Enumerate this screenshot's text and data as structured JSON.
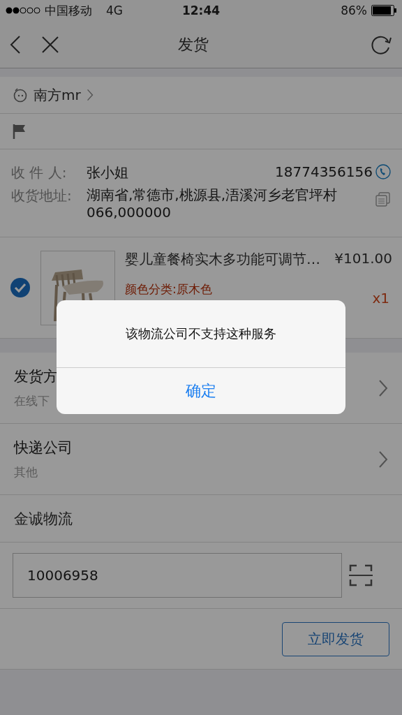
{
  "status_bar": {
    "carrier": "中国移动",
    "network": "4G",
    "time": "12:44",
    "battery": "86%"
  },
  "nav": {
    "title": "发货"
  },
  "shop": {
    "name": "南方mr"
  },
  "recipient": {
    "name_label": "收 件 人:",
    "name": "张小姐",
    "phone": "18774356156",
    "address_label": "收货地址:",
    "address": "湖南省,常德市,桃源县,浯溪河乡老官坪村066,000000"
  },
  "product": {
    "selected": true,
    "title": "婴儿童餐椅实木多功能可调节…",
    "price": "¥101.00",
    "spec": "颜色分类:原木色",
    "quantity": "x1"
  },
  "options": [
    {
      "title": "发货方",
      "subtitle": "在线下"
    },
    {
      "title": "快递公司",
      "subtitle": "其他"
    }
  ],
  "company": "金诚物流",
  "tracking": {
    "value": "10006958"
  },
  "submit": "立即发货",
  "dialog": {
    "message": "该物流公司不支持这种服务",
    "button": "确定"
  }
}
